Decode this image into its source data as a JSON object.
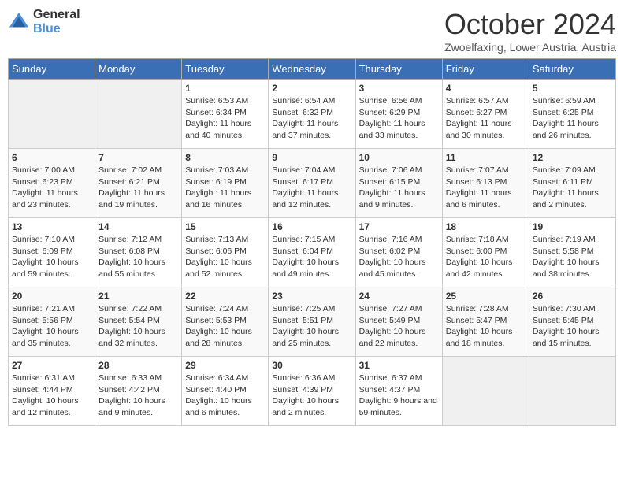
{
  "header": {
    "logo_general": "General",
    "logo_blue": "Blue",
    "title": "October 2024",
    "location": "Zwoelfaxing, Lower Austria, Austria"
  },
  "days_of_week": [
    "Sunday",
    "Monday",
    "Tuesday",
    "Wednesday",
    "Thursday",
    "Friday",
    "Saturday"
  ],
  "weeks": [
    [
      {
        "day": "",
        "empty": true
      },
      {
        "day": "",
        "empty": true
      },
      {
        "day": "1",
        "rise": "6:53 AM",
        "set": "6:34 PM",
        "daylight": "11 hours and 40 minutes."
      },
      {
        "day": "2",
        "rise": "6:54 AM",
        "set": "6:32 PM",
        "daylight": "11 hours and 37 minutes."
      },
      {
        "day": "3",
        "rise": "6:56 AM",
        "set": "6:29 PM",
        "daylight": "11 hours and 33 minutes."
      },
      {
        "day": "4",
        "rise": "6:57 AM",
        "set": "6:27 PM",
        "daylight": "11 hours and 30 minutes."
      },
      {
        "day": "5",
        "rise": "6:59 AM",
        "set": "6:25 PM",
        "daylight": "11 hours and 26 minutes."
      }
    ],
    [
      {
        "day": "6",
        "rise": "7:00 AM",
        "set": "6:23 PM",
        "daylight": "11 hours and 23 minutes."
      },
      {
        "day": "7",
        "rise": "7:02 AM",
        "set": "6:21 PM",
        "daylight": "11 hours and 19 minutes."
      },
      {
        "day": "8",
        "rise": "7:03 AM",
        "set": "6:19 PM",
        "daylight": "11 hours and 16 minutes."
      },
      {
        "day": "9",
        "rise": "7:04 AM",
        "set": "6:17 PM",
        "daylight": "11 hours and 12 minutes."
      },
      {
        "day": "10",
        "rise": "7:06 AM",
        "set": "6:15 PM",
        "daylight": "11 hours and 9 minutes."
      },
      {
        "day": "11",
        "rise": "7:07 AM",
        "set": "6:13 PM",
        "daylight": "11 hours and 6 minutes."
      },
      {
        "day": "12",
        "rise": "7:09 AM",
        "set": "6:11 PM",
        "daylight": "11 hours and 2 minutes."
      }
    ],
    [
      {
        "day": "13",
        "rise": "7:10 AM",
        "set": "6:09 PM",
        "daylight": "10 hours and 59 minutes."
      },
      {
        "day": "14",
        "rise": "7:12 AM",
        "set": "6:08 PM",
        "daylight": "10 hours and 55 minutes."
      },
      {
        "day": "15",
        "rise": "7:13 AM",
        "set": "6:06 PM",
        "daylight": "10 hours and 52 minutes."
      },
      {
        "day": "16",
        "rise": "7:15 AM",
        "set": "6:04 PM",
        "daylight": "10 hours and 49 minutes."
      },
      {
        "day": "17",
        "rise": "7:16 AM",
        "set": "6:02 PM",
        "daylight": "10 hours and 45 minutes."
      },
      {
        "day": "18",
        "rise": "7:18 AM",
        "set": "6:00 PM",
        "daylight": "10 hours and 42 minutes."
      },
      {
        "day": "19",
        "rise": "7:19 AM",
        "set": "5:58 PM",
        "daylight": "10 hours and 38 minutes."
      }
    ],
    [
      {
        "day": "20",
        "rise": "7:21 AM",
        "set": "5:56 PM",
        "daylight": "10 hours and 35 minutes."
      },
      {
        "day": "21",
        "rise": "7:22 AM",
        "set": "5:54 PM",
        "daylight": "10 hours and 32 minutes."
      },
      {
        "day": "22",
        "rise": "7:24 AM",
        "set": "5:53 PM",
        "daylight": "10 hours and 28 minutes."
      },
      {
        "day": "23",
        "rise": "7:25 AM",
        "set": "5:51 PM",
        "daylight": "10 hours and 25 minutes."
      },
      {
        "day": "24",
        "rise": "7:27 AM",
        "set": "5:49 PM",
        "daylight": "10 hours and 22 minutes."
      },
      {
        "day": "25",
        "rise": "7:28 AM",
        "set": "5:47 PM",
        "daylight": "10 hours and 18 minutes."
      },
      {
        "day": "26",
        "rise": "7:30 AM",
        "set": "5:45 PM",
        "daylight": "10 hours and 15 minutes."
      }
    ],
    [
      {
        "day": "27",
        "rise": "6:31 AM",
        "set": "4:44 PM",
        "daylight": "10 hours and 12 minutes."
      },
      {
        "day": "28",
        "rise": "6:33 AM",
        "set": "4:42 PM",
        "daylight": "10 hours and 9 minutes."
      },
      {
        "day": "29",
        "rise": "6:34 AM",
        "set": "4:40 PM",
        "daylight": "10 hours and 6 minutes."
      },
      {
        "day": "30",
        "rise": "6:36 AM",
        "set": "4:39 PM",
        "daylight": "10 hours and 2 minutes."
      },
      {
        "day": "31",
        "rise": "6:37 AM",
        "set": "4:37 PM",
        "daylight": "9 hours and 59 minutes."
      },
      {
        "day": "",
        "empty": true
      },
      {
        "day": "",
        "empty": true
      }
    ]
  ],
  "labels": {
    "sunrise": "Sunrise:",
    "sunset": "Sunset:",
    "daylight": "Daylight:"
  }
}
